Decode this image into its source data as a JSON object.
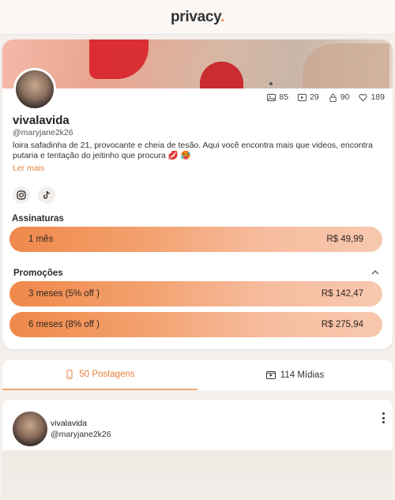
{
  "header": {
    "logo_text": "privacy",
    "logo_dot": "."
  },
  "profile": {
    "name": "vivalavida",
    "handle": "@maryjane2k26",
    "bio": "loira safadinha de 21, provocante e cheia de tesão. Aqui você encontra mais que videos, encontra putaria e tentação do jeitinho que procura 💋 🥵",
    "read_more": "Ler mais",
    "stats": [
      {
        "icon": "image-icon",
        "value": "85"
      },
      {
        "icon": "video-icon",
        "value": "29"
      },
      {
        "icon": "lock-icon",
        "value": "90"
      },
      {
        "icon": "heart-icon",
        "value": "189"
      }
    ],
    "social": [
      {
        "icon": "instagram-icon"
      },
      {
        "icon": "tiktok-icon"
      }
    ]
  },
  "subscriptions": {
    "title": "Assinaturas",
    "plans": [
      {
        "label": "1 mês",
        "price": "R$ 49,99"
      }
    ]
  },
  "promotions": {
    "title": "Promoções",
    "plans": [
      {
        "label": "3 meses (5% off )",
        "price": "R$ 142,47"
      },
      {
        "label": "6 meses (8% off )",
        "price": "R$ 275,94"
      }
    ]
  },
  "tabs": [
    {
      "label": "50 Postagens",
      "icon": "phone-icon",
      "active": true
    },
    {
      "label": "114 Mídias",
      "icon": "media-icon",
      "active": false
    }
  ],
  "post": {
    "name": "vivalavida",
    "handle": "@maryjane2k26"
  },
  "colors": {
    "accent": "#e8803a",
    "plan_gradient_start": "#f0884a",
    "plan_gradient_end": "#f8c8ae"
  }
}
